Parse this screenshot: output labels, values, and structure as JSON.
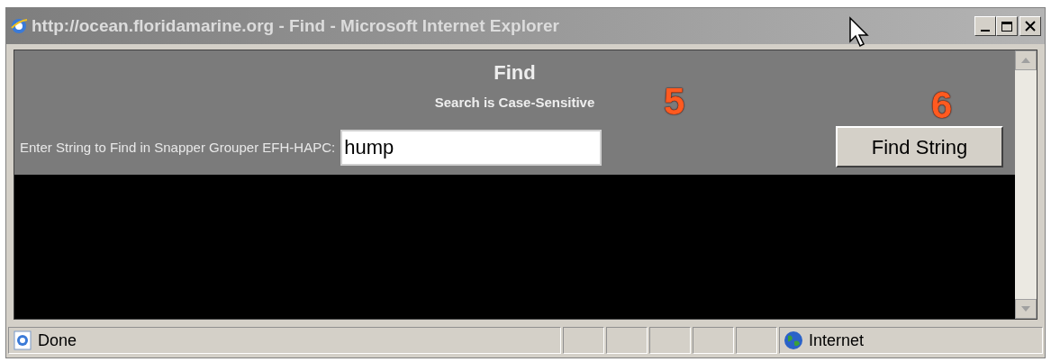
{
  "window": {
    "title": "http://ocean.floridamarine.org - Find - Microsoft Internet Explorer"
  },
  "page": {
    "heading": "Find",
    "note": "Search is Case-Sensitive",
    "field_label": "Enter String to Find in Snapper Grouper EFH-HAPC:",
    "field_value": "hump",
    "button": "Find String"
  },
  "callouts": [
    "5",
    "6"
  ],
  "status_bar": {
    "text": "Done",
    "zone": "Internet"
  }
}
